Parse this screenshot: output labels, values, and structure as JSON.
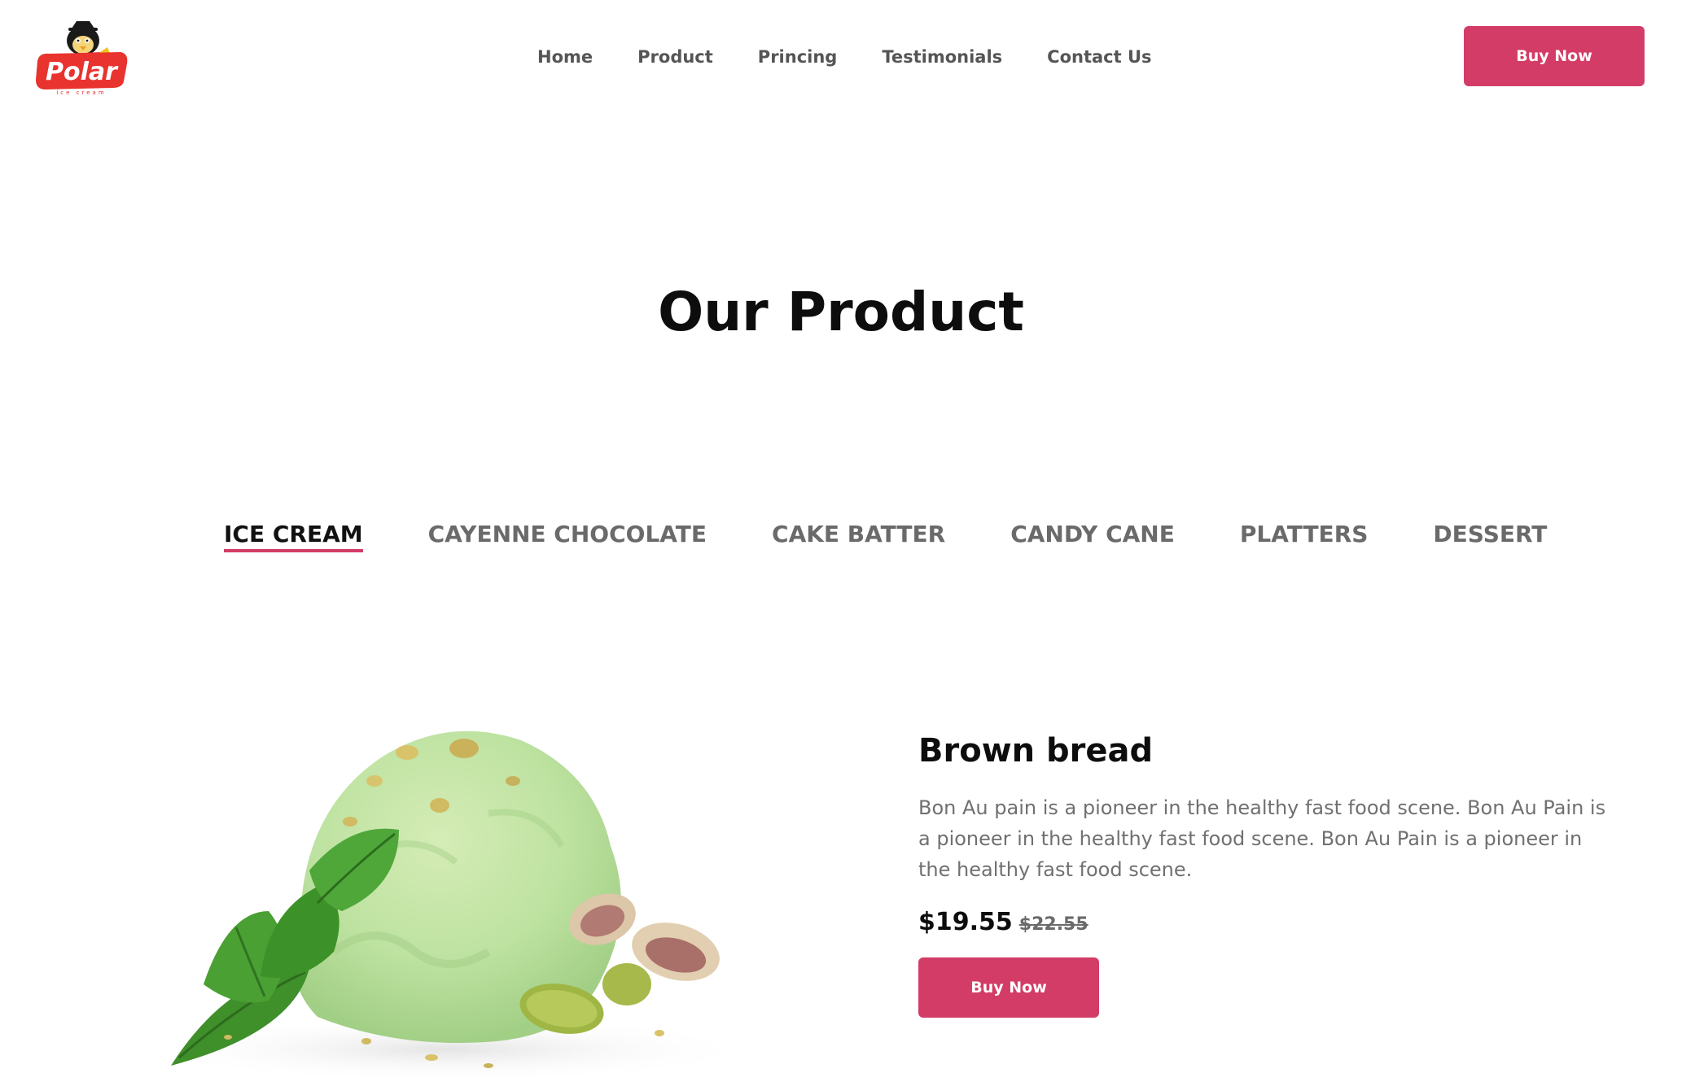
{
  "brand": {
    "logo_text": "Polar",
    "logo_subtext": "ice cream",
    "primary_color": "#d33c66"
  },
  "nav": {
    "items": [
      {
        "label": "Home"
      },
      {
        "label": "Product"
      },
      {
        "label": "Princing"
      },
      {
        "label": "Testimonials"
      },
      {
        "label": "Contact Us"
      }
    ],
    "buy_label": "Buy Now"
  },
  "section": {
    "title": "Our Product"
  },
  "tabs": {
    "active_index": 0,
    "items": [
      {
        "label": "ICE CREAM"
      },
      {
        "label": "CAYENNE CHOCOLATE"
      },
      {
        "label": "CAKE BATTER"
      },
      {
        "label": "CANDY CANE"
      },
      {
        "label": "PLATTERS"
      },
      {
        "label": "DESSERT"
      }
    ]
  },
  "product": {
    "image_icon": "pistachio-ice-cream-scoop-image",
    "name": "Brown bread",
    "description": "Bon Au pain is a pioneer in the healthy fast food scene. Bon Au Pain is a pioneer in the healthy fast food scene. Bon Au Pain is a pioneer in the healthy fast food scene.",
    "price": "$19.55",
    "old_price": "$22.55",
    "buy_label": "Buy Now"
  }
}
